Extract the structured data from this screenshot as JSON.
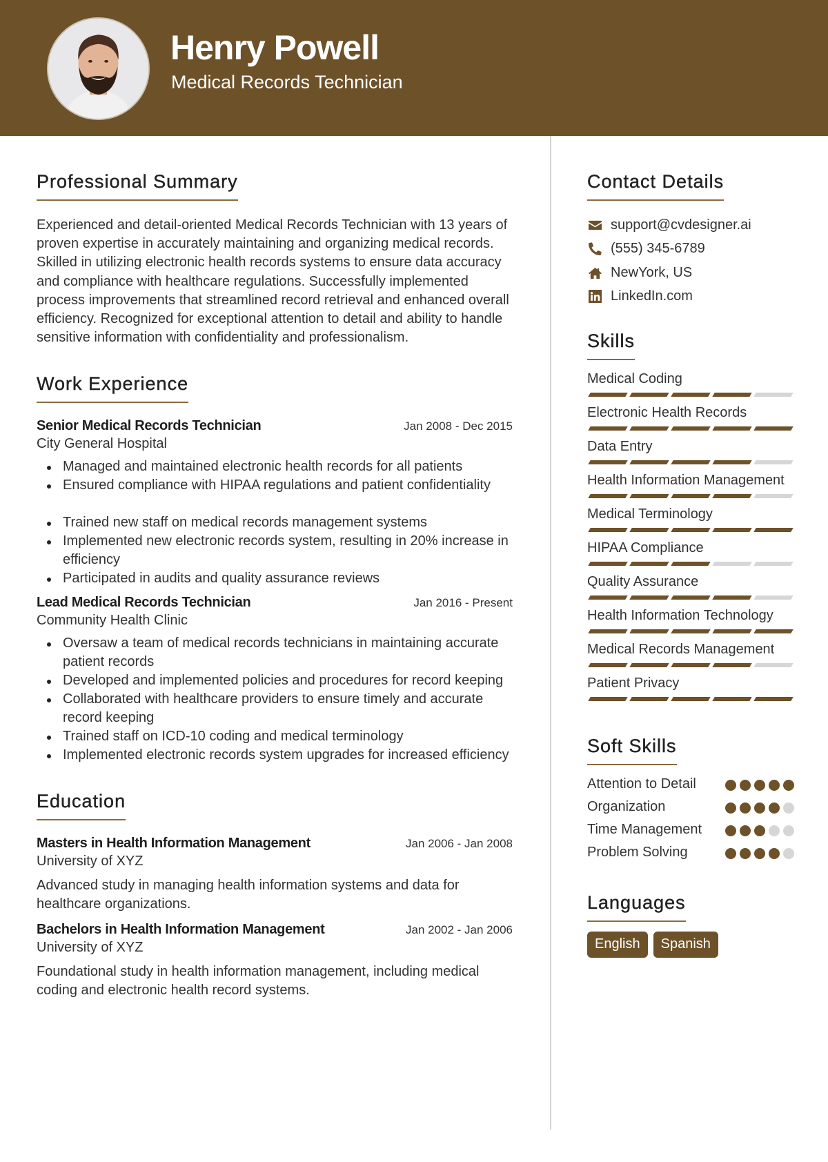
{
  "header": {
    "name": "Henry Powell",
    "title": "Medical Records Technician",
    "brand_color": "#6d5129"
  },
  "summary": {
    "heading": "Professional Summary",
    "text": "Experienced and detail-oriented Medical Records Technician with 13 years of proven expertise in accurately maintaining and organizing medical records. Skilled in utilizing electronic health records systems to ensure data accuracy and compliance with healthcare regulations. Successfully implemented process improvements that streamlined record retrieval and enhanced overall efficiency. Recognized for exceptional attention to detail and ability to handle sensitive information with confidentiality and professionalism."
  },
  "experience": {
    "heading": "Work Experience",
    "jobs": [
      {
        "role": "Senior Medical Records Technician",
        "dates": "Jan 2008 - Dec 2015",
        "org": "City General Hospital",
        "bullets": [
          "Managed and maintained electronic health records for all patients",
          "Ensured compliance with HIPAA regulations and patient confidentiality",
          "Trained new staff on medical records management systems",
          "Implemented new electronic records system, resulting in 20% increase in efficiency",
          "Participated in audits and quality assurance reviews"
        ]
      },
      {
        "role": "Lead Medical Records Technician",
        "dates": "Jan 2016 - Present",
        "org": "Community Health Clinic",
        "bullets": [
          "Oversaw a team of medical records technicians in maintaining accurate patient records",
          "Developed and implemented policies and procedures for record keeping",
          "Collaborated with healthcare providers to ensure timely and accurate record keeping",
          "Trained staff on ICD-10 coding and medical terminology",
          "Implemented electronic records system upgrades for increased efficiency"
        ]
      }
    ]
  },
  "education": {
    "heading": "Education",
    "items": [
      {
        "degree": "Masters in Health Information Management",
        "dates": "Jan 2006 - Jan 2008",
        "school": "University of XYZ",
        "desc": "Advanced study in managing health information systems and data for healthcare organizations."
      },
      {
        "degree": "Bachelors in Health Information Management",
        "dates": "Jan 2002 - Jan 2006",
        "school": "University of XYZ",
        "desc": "Foundational study in health information management, including medical coding and electronic health record systems."
      }
    ]
  },
  "contact": {
    "heading": "Contact Details",
    "items": [
      {
        "icon": "envelope-icon",
        "text": "support@cvdesigner.ai"
      },
      {
        "icon": "phone-icon",
        "text": "(555) 345-6789"
      },
      {
        "icon": "home-icon",
        "text": "NewYork, US"
      },
      {
        "icon": "linkedin-icon",
        "text": "LinkedIn.com"
      }
    ]
  },
  "skills": {
    "heading": "Skills",
    "max": 5,
    "items": [
      {
        "name": "Medical Coding",
        "level": 4
      },
      {
        "name": "Electronic Health Records",
        "level": 5
      },
      {
        "name": "Data Entry",
        "level": 4
      },
      {
        "name": "Health Information Management",
        "level": 4
      },
      {
        "name": "Medical Terminology",
        "level": 5
      },
      {
        "name": "HIPAA Compliance",
        "level": 3
      },
      {
        "name": "Quality Assurance",
        "level": 4
      },
      {
        "name": "Health Information Technology",
        "level": 5
      },
      {
        "name": "Medical Records Management",
        "level": 4
      },
      {
        "name": "Patient Privacy",
        "level": 5
      }
    ]
  },
  "soft_skills": {
    "heading": "Soft Skills",
    "max": 5,
    "items": [
      {
        "name": "Attention to Detail",
        "level": 5
      },
      {
        "name": "Organization",
        "level": 4
      },
      {
        "name": "Time Management",
        "level": 3
      },
      {
        "name": "Problem Solving",
        "level": 4
      }
    ]
  },
  "languages": {
    "heading": "Languages",
    "items": [
      "English",
      "Spanish"
    ]
  }
}
